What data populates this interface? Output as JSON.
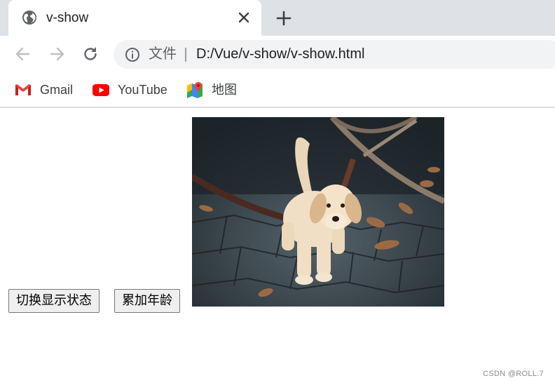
{
  "tab": {
    "title": "v-show",
    "favicon": "globe-icon",
    "close_icon": "close-icon",
    "new_tab_icon": "plus-icon"
  },
  "toolbar": {
    "back_icon": "arrow-left-icon",
    "forward_icon": "arrow-right-icon",
    "reload_icon": "reload-icon",
    "info_icon": "info-icon",
    "scheme_label": "文件",
    "url": "D:/Vue/v-show/v-show.html"
  },
  "bookmarks": [
    {
      "label": "Gmail",
      "icon": "gmail-icon"
    },
    {
      "label": "YouTube",
      "icon": "youtube-icon"
    },
    {
      "label": "地图",
      "icon": "maps-icon"
    }
  ],
  "page": {
    "toggle_button": "切换显示状态",
    "age_button": "累加年龄",
    "image_subject": "puppy",
    "watermark": "CSDN @ROLL.7"
  },
  "colors": {
    "tabstrip_bg": "#dee1e6",
    "omnibox_bg": "#f1f3f4",
    "gmail_red": "#ea4335",
    "youtube_red": "#ff0000"
  }
}
